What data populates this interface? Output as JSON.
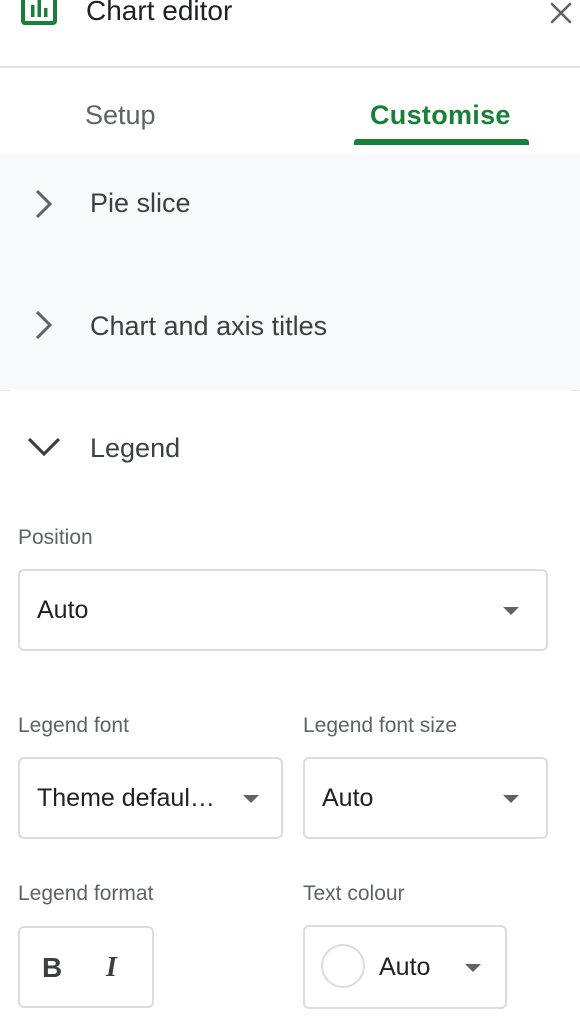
{
  "header": {
    "title": "Chart editor",
    "icon": "bar-chart-icon",
    "close_icon": "close-icon",
    "accent_color": "#188038"
  },
  "tabs": [
    {
      "label": "Setup",
      "active": false
    },
    {
      "label": "Customise",
      "active": true
    }
  ],
  "sections": [
    {
      "label": "Pie slice",
      "expanded": false
    },
    {
      "label": "Chart and axis titles",
      "expanded": false
    },
    {
      "label": "Legend",
      "expanded": true
    }
  ],
  "legend": {
    "position": {
      "label": "Position",
      "value": "Auto"
    },
    "font": {
      "label": "Legend font",
      "value": "Theme defaul…"
    },
    "font_size": {
      "label": "Legend font size",
      "value": "Auto"
    },
    "format": {
      "label": "Legend format",
      "bold": "B",
      "italic": "I"
    },
    "text_colour": {
      "label": "Text colour",
      "value": "Auto",
      "swatch_color": "#ffffff"
    }
  }
}
